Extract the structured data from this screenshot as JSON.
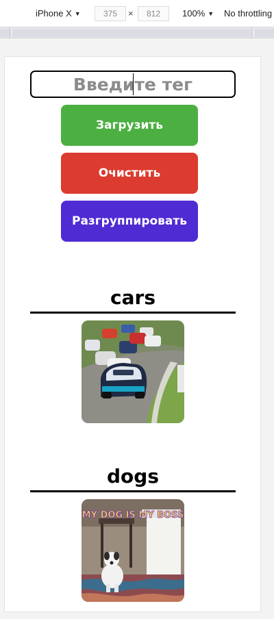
{
  "devtools": {
    "device": "iPhone X",
    "width": "375",
    "times": "×",
    "height": "812",
    "zoom": "100%",
    "throttling": "No throttling"
  },
  "page": {
    "tag_input": {
      "placeholder": "Введите тег",
      "value": ""
    },
    "buttons": {
      "load": "Загрузить",
      "clear": "Очистить",
      "ungroup": "Разгруппировать"
    },
    "groups": [
      {
        "title": "cars"
      },
      {
        "title": "dogs",
        "image_caption": "MY DOG IS MY BOSS"
      }
    ]
  },
  "colors": {
    "load_button": "#4caf42",
    "clear_button": "#dc3b2f",
    "ungroup_button": "#4f2bd3"
  }
}
